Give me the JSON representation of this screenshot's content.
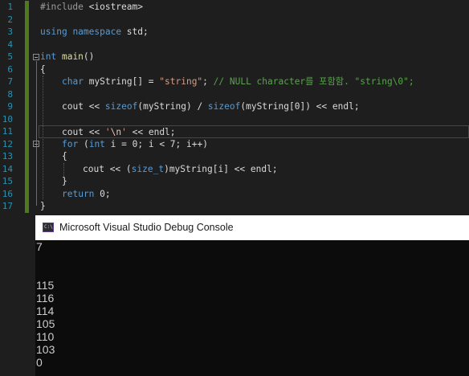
{
  "editor": {
    "line_numbers": [
      "1",
      "2",
      "3",
      "4",
      "5",
      "6",
      "7",
      "8",
      "9",
      "10",
      "11",
      "12",
      "13",
      "14",
      "15",
      "16",
      "17"
    ],
    "code": {
      "l1": {
        "a": "#include",
        "b": " <iostream>"
      },
      "l3": {
        "a": "using",
        "b": " ",
        "c": "namespace",
        "d": " std;"
      },
      "l5": {
        "a": "int",
        "b": " ",
        "c": "main",
        "d": "()"
      },
      "l6": {
        "a": "{"
      },
      "l7": {
        "a": "char",
        "b": " ",
        "c": "myString",
        "d": "[] = ",
        "e": "\"string\"",
        "f": "; ",
        "g": "// NULL character를 포함함. \"string\\0\";"
      },
      "l9": {
        "a": "cout",
        "b": " << ",
        "c": "sizeof",
        "d": "(",
        "e": "myString",
        "f": ") / ",
        "g": "sizeof",
        "h": "(",
        "i": "myString",
        "j": "[0]) << ",
        "k": "endl",
        "l": ";"
      },
      "l11": {
        "a": "cout",
        "b": " << ",
        "c": "'",
        "d": "\\n",
        "e": "'",
        "f": " << ",
        "g": "endl",
        "h": ";"
      },
      "l12": {
        "a": "for",
        "b": " (",
        "c": "int",
        "d": " ",
        "e": "i",
        "f": " = 0; ",
        "g": "i",
        "h": " < 7; ",
        "i": "i",
        "j": "++)"
      },
      "l13": {
        "a": "{"
      },
      "l14": {
        "a": "cout",
        "b": " << (",
        "c": "size_t",
        "d": ")",
        "e": "myString",
        "f": "[",
        "g": "i",
        "h": "] << ",
        "i": "endl",
        "j": ";"
      },
      "l15": {
        "a": "}"
      },
      "l16": {
        "a": "return",
        "b": " 0;"
      },
      "l17": {
        "a": "}"
      }
    }
  },
  "console": {
    "title": "Microsoft Visual Studio Debug Console",
    "icon_label": "C:\\",
    "output_lines": [
      "7",
      "",
      "",
      "115",
      "116",
      "114",
      "105",
      "110",
      "103",
      "0"
    ]
  },
  "colors": {
    "keyword": "#569cd6",
    "string": "#d69d85",
    "comment": "#57a64a",
    "function": "#dcdcaa",
    "line_number": "#2b91af",
    "change_bar": "#4e7a1e"
  }
}
